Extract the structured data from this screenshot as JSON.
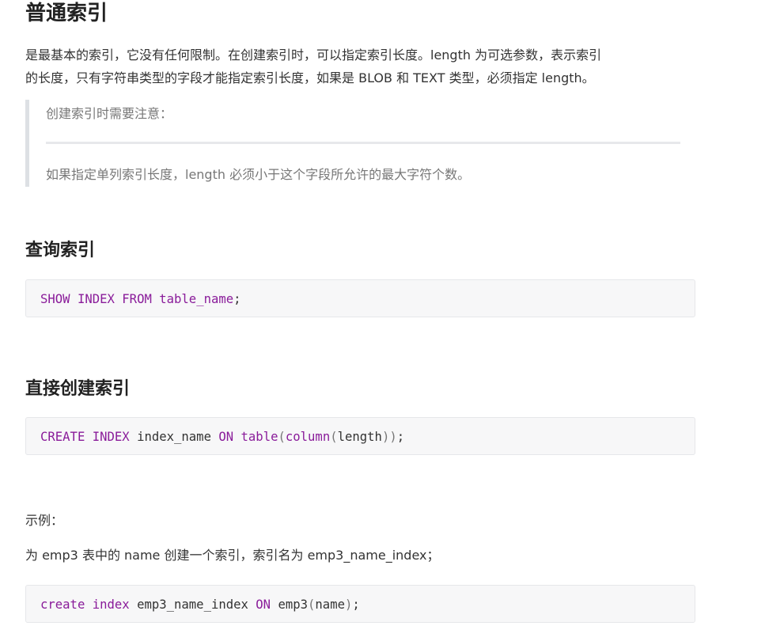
{
  "heading_main": "普通索引",
  "intro": {
    "line1": "是最基本的索引，它没有任何限制。在创建索引时，可以指定索引长度。length 为可选参数，表示索引",
    "line2": "的长度，只有字符串类型的字段才能指定索引长度，如果是 BLOB 和 TEXT 类型，必须指定 length。"
  },
  "note": {
    "title": "创建索引时需要注意：",
    "body": "如果指定单列索引长度，length 必须小于这个字段所允许的最大字符个数。"
  },
  "section_query": {
    "heading": "查询索引",
    "code": {
      "kw1": "SHOW",
      "sp1": " ",
      "kw2": "INDEX",
      "sp2": " ",
      "kw3": "FROM",
      "sp3": " ",
      "kw4": "table_name",
      "p1": ";"
    }
  },
  "section_create": {
    "heading": "直接创建索引",
    "code": {
      "kw1": "CREATE",
      "sp1": " ",
      "kw2": "INDEX",
      "t1": " index_name ",
      "kw3": "ON",
      "sp2": " ",
      "kw4": "table",
      "p1": "(",
      "kw5": "column",
      "p2": "(",
      "t2": "length",
      "p3": "))",
      "t3": ";"
    }
  },
  "example": {
    "label": "示例：",
    "desc": "为 emp3 表中的 name 创建一个索引，索引名为 emp3_name_index；",
    "code": {
      "kw1": "create",
      "sp1": " ",
      "kw2": "index",
      "t1": " emp3_name_index ",
      "kw3": "ON",
      "t2": " emp3",
      "p1": "(",
      "t3": "name",
      "p2": ")",
      "t4": ";"
    }
  }
}
